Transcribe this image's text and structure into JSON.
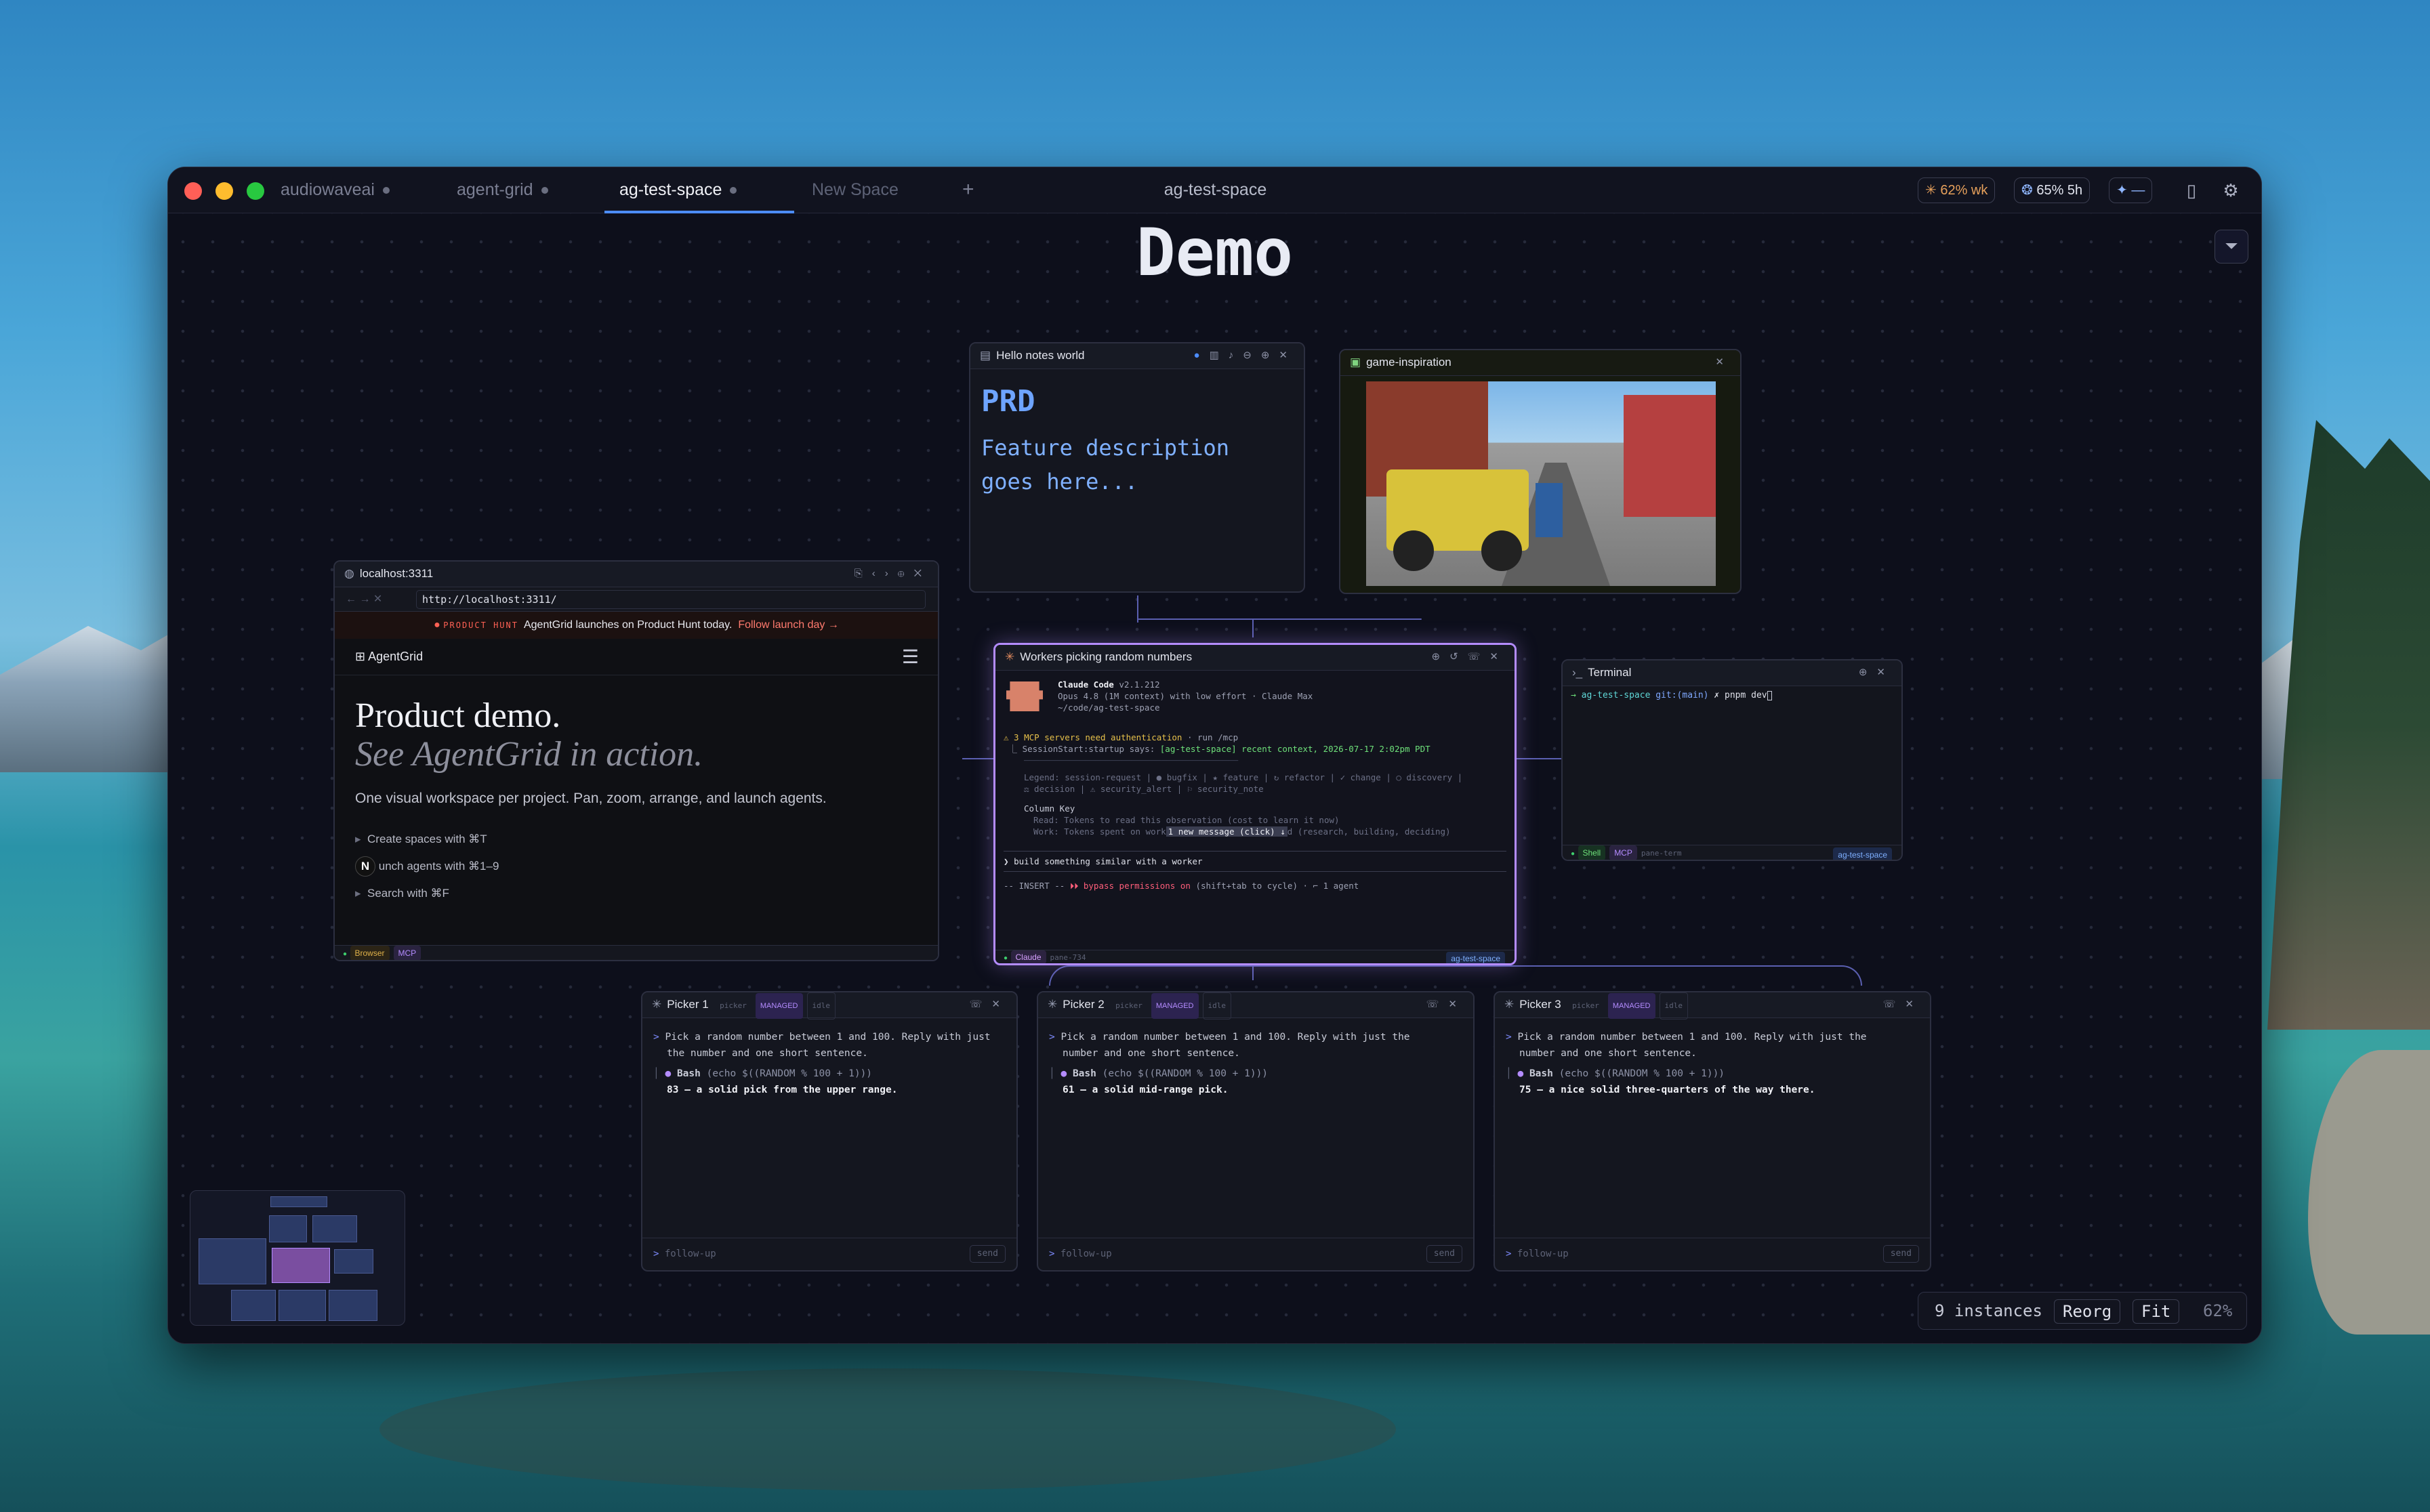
{
  "tabs": [
    {
      "label": "audiowaveai"
    },
    {
      "label": "agent-grid"
    },
    {
      "label": "ag-test-space"
    },
    {
      "label": "New Space"
    }
  ],
  "add_tab": "+",
  "window_title": "ag-test-space",
  "usage": {
    "claude": "62% wk",
    "openai": "65% 5h",
    "gemini": "—"
  },
  "canvas_title": "Demo",
  "notes": {
    "title": "Hello notes world",
    "heading": "PRD",
    "body1": "Feature description",
    "body2": "goes here..."
  },
  "image": {
    "title": "game-inspiration"
  },
  "browser": {
    "title": "localhost:3311",
    "url": "http://localhost:3311/",
    "banner_tag": "PRODUCT HUNT",
    "banner_text": "AgentGrid launches on Product Hunt today.",
    "banner_link": "Follow launch day →",
    "brand": "AgentGrid",
    "h1": "Product demo.",
    "h2": "See AgentGrid in action.",
    "lead": "One visual workspace per project. Pan, zoom, arrange, and launch agents.",
    "items": [
      "Create spaces with ⌘T",
      "unch agents with ⌘1–9",
      "Search with ⌘F"
    ],
    "chip1": "Browser",
    "chip2": "MCP"
  },
  "claude": {
    "title": "Workers picking random numbers",
    "app": "Claude Code",
    "version": "v2.1.212",
    "model": "Opus 4.8 (1M context) with low effort · Claude Max",
    "cwd": "~/code/ag-test-space",
    "warn": "⚠ 3 MCP servers need authentication",
    "warn_hint": "· run /mcp",
    "session": "SessionStart:startup says:",
    "session_ctx": "[ag-test-space] recent context, 2026-07-17 2:02pm PDT",
    "legend1": "Legend: session-request | ● bugfix | ★ feature | ↻ refactor | ✓ change | ○ discovery |",
    "legend2": "⚖ decision | ⚠ security_alert | ⚐ security_note",
    "col_key": "Column Key",
    "read": "Read: Tokens to read this observation (cost to learn it now)",
    "work": "Work: Tokens spent on work",
    "new_msg": "1 new message (click) ↓",
    "work_tail": "d (research, building, deciding)",
    "prompt": "build something similar with a worker",
    "mode": "-- INSERT --",
    "bypass": "⏵⏵ bypass permissions on",
    "mode_tail": "(shift+tab to cycle) · ⌐ 1 agent",
    "chip1": "Claude",
    "chip2": "pane-734",
    "space": "ag-test-space"
  },
  "terminal": {
    "title": "Terminal",
    "line_dir": "ag-test-space",
    "line_git": "git:(main)",
    "line_cmd": "✗ pnpm dev",
    "chip1": "Shell",
    "chip2": "MCP",
    "chip3": "pane-term",
    "space": "ag-test-space"
  },
  "pickers": [
    {
      "title": "Picker 1",
      "role": "picker",
      "badge": "MANAGED",
      "status": "idle",
      "prompt1": "Pick a random number between 1 and 100. Reply with just",
      "prompt2": "the number and one short sentence.",
      "tool": "Bash",
      "cmd": "(echo $((RANDOM % 100 + 1)))",
      "answer": "83 — a solid pick from the upper range.",
      "follow": "follow-up",
      "send": "send"
    },
    {
      "title": "Picker 2",
      "role": "picker",
      "badge": "MANAGED",
      "status": "idle",
      "prompt1": "Pick a random number between 1 and 100. Reply with just the",
      "prompt2": "number and one short sentence.",
      "tool": "Bash",
      "cmd": "(echo $((RANDOM % 100 + 1)))",
      "answer": "61 — a solid mid-range pick.",
      "follow": "follow-up",
      "send": "send"
    },
    {
      "title": "Picker 3",
      "role": "picker",
      "badge": "MANAGED",
      "status": "idle",
      "prompt1": "Pick a random number between 1 and 100. Reply with just the",
      "prompt2": "number and one short sentence.",
      "tool": "Bash",
      "cmd": "(echo $((RANDOM % 100 + 1)))",
      "answer": "75 — a nice solid three-quarters of the way there.",
      "follow": "follow-up",
      "send": "send"
    }
  ],
  "footer": {
    "instances": "9 instances",
    "reorg": "Reorg",
    "fit": "Fit",
    "zoom": "62%"
  },
  "colors": {
    "accent": "#4c8cff",
    "claude_border": "#b48cff",
    "canvas": "#0d0f1b"
  }
}
